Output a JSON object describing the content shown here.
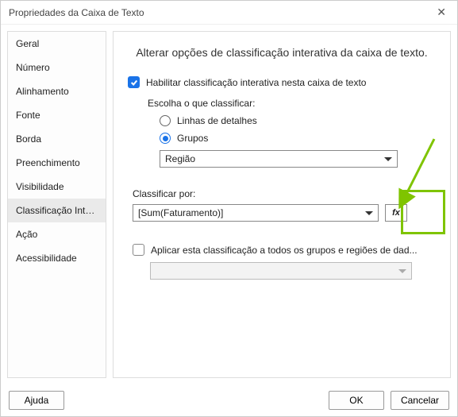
{
  "dialog": {
    "title": "Propriedades da Caixa de Texto"
  },
  "sidebar": {
    "items": [
      {
        "label": "Geral"
      },
      {
        "label": "Número"
      },
      {
        "label": "Alinhamento"
      },
      {
        "label": "Fonte"
      },
      {
        "label": "Borda"
      },
      {
        "label": "Preenchimento"
      },
      {
        "label": "Visibilidade"
      },
      {
        "label": "Classificação Interat..."
      },
      {
        "label": "Ação"
      },
      {
        "label": "Acessibilidade"
      }
    ],
    "selected_index": 7
  },
  "main": {
    "heading": "Alterar opções de classificação interativa da caixa de texto.",
    "enable_label": "Habilitar classificação interativa nesta caixa de texto",
    "enable_checked": true,
    "choose_label": "Escolha o que classificar:",
    "radio_detail": "Linhas de detalhes",
    "radio_groups": "Grupos",
    "radio_selected": "groups",
    "group_dropdown_value": "Região",
    "sortby_label": "Classificar por:",
    "sortby_value": "[Sum(Faturamento)]",
    "fx_label": "fx",
    "apply_label": "Aplicar esta classificação a todos os grupos e regiões de dad...",
    "apply_checked": false
  },
  "footer": {
    "help": "Ajuda",
    "ok": "OK",
    "cancel": "Cancelar"
  }
}
